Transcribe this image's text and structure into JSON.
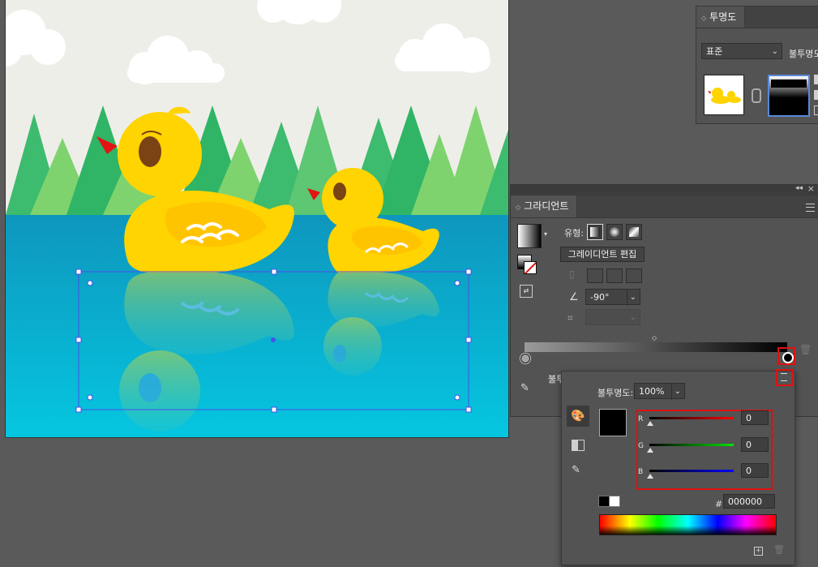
{
  "transparency_panel": {
    "tab_label": "투명도",
    "blend_mode": "표준",
    "opacity_label": "불투명도"
  },
  "gradient_panel": {
    "tab_label": "그라디언트",
    "type_label": "유형:",
    "edit_button_label": "그레이디언트 편집",
    "angle_value": "-90°",
    "opacity_label_partial": "불투",
    "gradient_start_color": "#9a9a9a",
    "gradient_end_color": "#000000"
  },
  "color_picker": {
    "opacity_label": "불투명도:",
    "opacity_value": "100%",
    "r_label": "R",
    "g_label": "G",
    "b_label": "B",
    "r_value": "0",
    "g_value": "0",
    "b_value": "0",
    "hex_prefix": "#",
    "hex_value": "000000",
    "swatch_color": "#000000"
  },
  "colors": {
    "highlight_red": "#e01010",
    "panel_bg": "#535353",
    "workspace_bg": "#5a5a5a"
  }
}
